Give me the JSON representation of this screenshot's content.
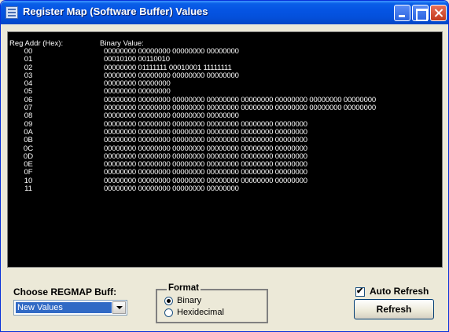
{
  "window": {
    "title": "Register Map (Software Buffer) Values"
  },
  "console": {
    "addr_header": "Reg Addr (Hex):",
    "bin_header": "Binary Value:",
    "rows": [
      {
        "addr": "00",
        "value": "00000000 00000000 00000000 00000000"
      },
      {
        "addr": "01",
        "value": "00010100 00110010"
      },
      {
        "addr": "02",
        "value": "00000000 01111111 00010001 11111111"
      },
      {
        "addr": "03",
        "value": "00000000 00000000 00000000 00000000"
      },
      {
        "addr": "04",
        "value": "00000000 00000000"
      },
      {
        "addr": "05",
        "value": "00000000 00000000"
      },
      {
        "addr": "06",
        "value": "00000000 00000000 00000000 00000000 00000000 00000000 00000000 00000000"
      },
      {
        "addr": "07",
        "value": "00000000 00000000 00000000 00000000 00000000 00000000 00000000 00000000"
      },
      {
        "addr": "08",
        "value": "00000000 00000000 00000000 00000000"
      },
      {
        "addr": "09",
        "value": "00000000 00000000 00000000 00000000 00000000 00000000"
      },
      {
        "addr": "0A",
        "value": "00000000 00000000 00000000 00000000 00000000 00000000"
      },
      {
        "addr": "0B",
        "value": "00000000 00000000 00000000 00000000 00000000 00000000"
      },
      {
        "addr": "0C",
        "value": "00000000 00000000 00000000 00000000 00000000 00000000"
      },
      {
        "addr": "0D",
        "value": "00000000 00000000 00000000 00000000 00000000 00000000"
      },
      {
        "addr": "0E",
        "value": "00000000 00000000 00000000 00000000 00000000 00000000"
      },
      {
        "addr": "0F",
        "value": "00000000 00000000 00000000 00000000 00000000 00000000"
      },
      {
        "addr": "10",
        "value": "00000000 00000000 00000000 00000000 00000000 00000000"
      },
      {
        "addr": "11",
        "value": "00000000 00000000 00000000 00000000"
      }
    ]
  },
  "controls": {
    "choose_label": "Choose REGMAP Buff:",
    "buffer_selected": "New Values",
    "format_legend": "Format",
    "format_binary": "Binary",
    "format_hex": "Hexidecimal",
    "format_selected": "Binary",
    "auto_refresh_label": "Auto Refresh",
    "auto_refresh_checked": true,
    "check_glyph": "✔",
    "refresh_label": "Refresh"
  },
  "colors": {
    "titlebar": "#0554e3",
    "console_bg": "#000000",
    "console_text": "#ffffff",
    "selection": "#316ac5"
  }
}
